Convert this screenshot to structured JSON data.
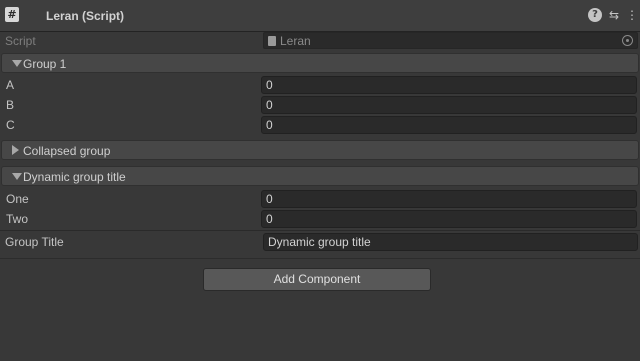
{
  "component": {
    "title": "Leran (Script)",
    "script_icon_glyph": "#",
    "help_glyph": "?",
    "preset_glyph": "⇆",
    "menu_glyph": "⋮"
  },
  "script_row": {
    "label": "Script",
    "value": "Leran"
  },
  "groups": [
    {
      "title": "Group 1",
      "expanded": true,
      "fields": [
        {
          "label": "A",
          "value": "0"
        },
        {
          "label": "B",
          "value": "0"
        },
        {
          "label": "C",
          "value": "0"
        }
      ]
    },
    {
      "title": "Collapsed group",
      "expanded": false,
      "fields": []
    },
    {
      "title": "Dynamic group title",
      "expanded": true,
      "fields": [
        {
          "label": "One",
          "value": "0"
        },
        {
          "label": "Two",
          "value": "0"
        }
      ]
    }
  ],
  "group_title_row": {
    "label": "Group Title",
    "value": "Dynamic group title"
  },
  "add_component_label": "Add Component",
  "colors": {
    "background": "#383838",
    "field": "#2a2a2a",
    "group_header": "#474747",
    "button": "#585858"
  }
}
